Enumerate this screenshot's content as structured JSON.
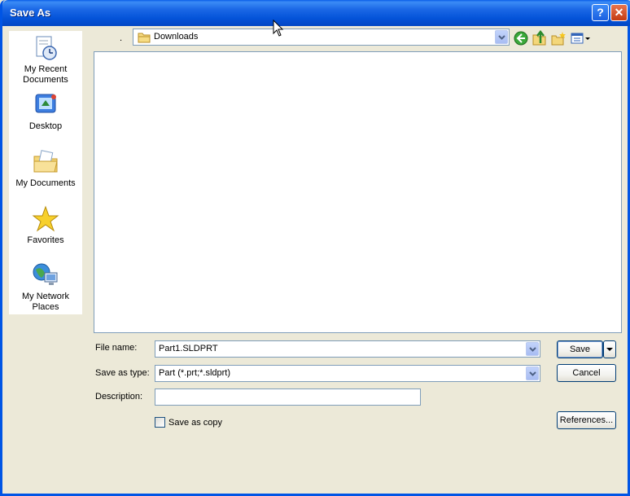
{
  "window": {
    "title": "Save As",
    "help_label": "?",
    "close_label": "✕"
  },
  "places": [
    {
      "label_lines": [
        "My Recent",
        "Documents"
      ],
      "icon": "recent-documents-icon"
    },
    {
      "label_lines": [
        "Desktop"
      ],
      "icon": "desktop-icon"
    },
    {
      "label_lines": [
        "My Documents"
      ],
      "icon": "my-documents-icon"
    },
    {
      "label_lines": [
        "Favorites"
      ],
      "icon": "favorites-star-icon"
    },
    {
      "label_lines": [
        "My Network",
        "Places"
      ],
      "icon": "network-places-icon"
    }
  ],
  "lookin": {
    "label": ".",
    "value": "Downloads",
    "icon": "folder-icon"
  },
  "toolbar": [
    "back-icon",
    "up-folder-icon",
    "new-folder-icon",
    "views-menu-icon"
  ],
  "form": {
    "filename_label": "File name:",
    "filename_value": "Part1.SLDPRT",
    "type_label": "Save as type:",
    "type_value": "Part (*.prt;*.sldprt)",
    "description_label": "Description:",
    "description_value": "",
    "save_as_copy_label": "Save as copy",
    "save_as_copy_checked": false
  },
  "buttons": {
    "save": "Save",
    "cancel": "Cancel",
    "references": "References..."
  },
  "colors": {
    "titlebar": "#0453d9",
    "frame": "#0055e5",
    "dialog_bg": "#ece9d8",
    "field_border": "#7f9db9"
  }
}
